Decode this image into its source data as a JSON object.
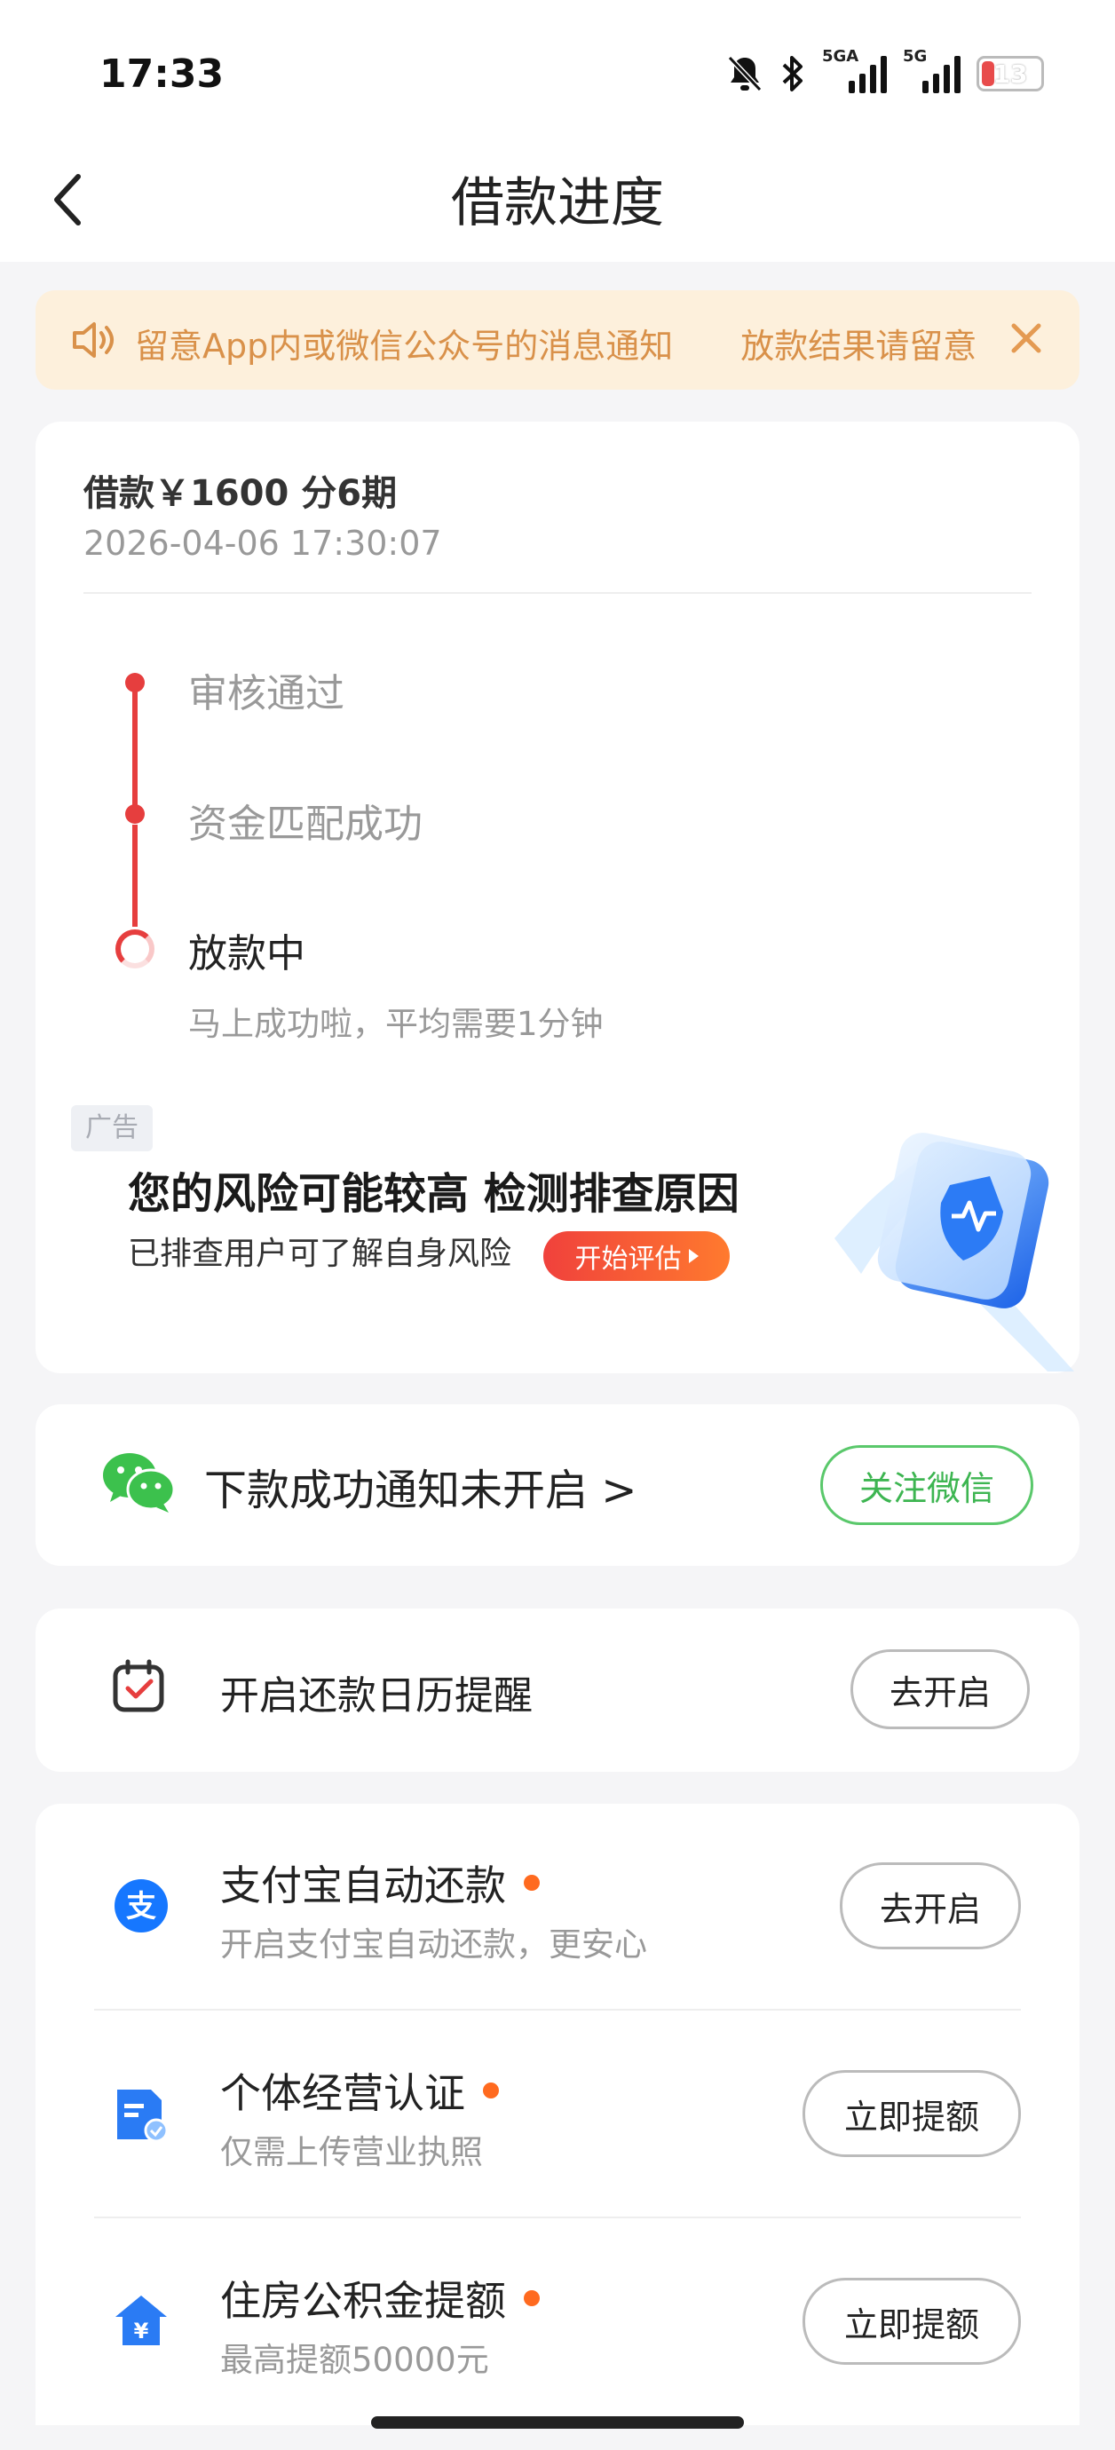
{
  "status_bar": {
    "time": "17:33",
    "network_1": "5GA",
    "network_2": "5G",
    "battery": "13",
    "icons": [
      "bell-off-icon",
      "bluetooth-icon",
      "signal-5ga-icon",
      "signal-5g-icon",
      "battery-icon"
    ]
  },
  "nav": {
    "title": "借款进度",
    "back_icon": "back-arrow-icon"
  },
  "notice": {
    "text": "留意App内或微信公众号的消息通知　　放款结果请留意",
    "speaker_icon": "speaker-icon",
    "close_icon": "close-icon"
  },
  "loan": {
    "title": "借款￥1600  分6期",
    "time": "2026-04-06 17:30:07",
    "steps": [
      {
        "label": "审核通过",
        "done": true
      },
      {
        "label": "资金匹配成功",
        "done": true
      },
      {
        "label": "放款中",
        "done": false,
        "sub": "马上成功啦，平均需要1分钟"
      }
    ]
  },
  "ad": {
    "tag": "广告",
    "headline": "您的风险可能较高 检测排查原因",
    "subtext": "已排查用户可了解自身风险",
    "button": "开始评估"
  },
  "wechat_notify": {
    "text": "下款成功通知未开启 >",
    "button": "关注微信"
  },
  "calendar": {
    "text": "开启还款日历提醒",
    "button": "去开启"
  },
  "services": [
    {
      "title": "支付宝自动还款",
      "sub": "开启支付宝自动还款，更安心",
      "button": "去开启",
      "icon": "alipay-icon"
    },
    {
      "title": "个体经营认证",
      "sub": "仅需上传营业执照",
      "button": "立即提额",
      "icon": "business-license-icon"
    },
    {
      "title": "住房公积金提额",
      "sub": "最高提额50000元",
      "button": "立即提额",
      "icon": "housing-fund-icon"
    }
  ],
  "colors": {
    "accent_red": "#e63e3e",
    "notice_bg": "#fdf0dc",
    "notice_text": "#d9914a",
    "wechat_green": "#3db551",
    "badge_orange": "#ff6a1f"
  }
}
